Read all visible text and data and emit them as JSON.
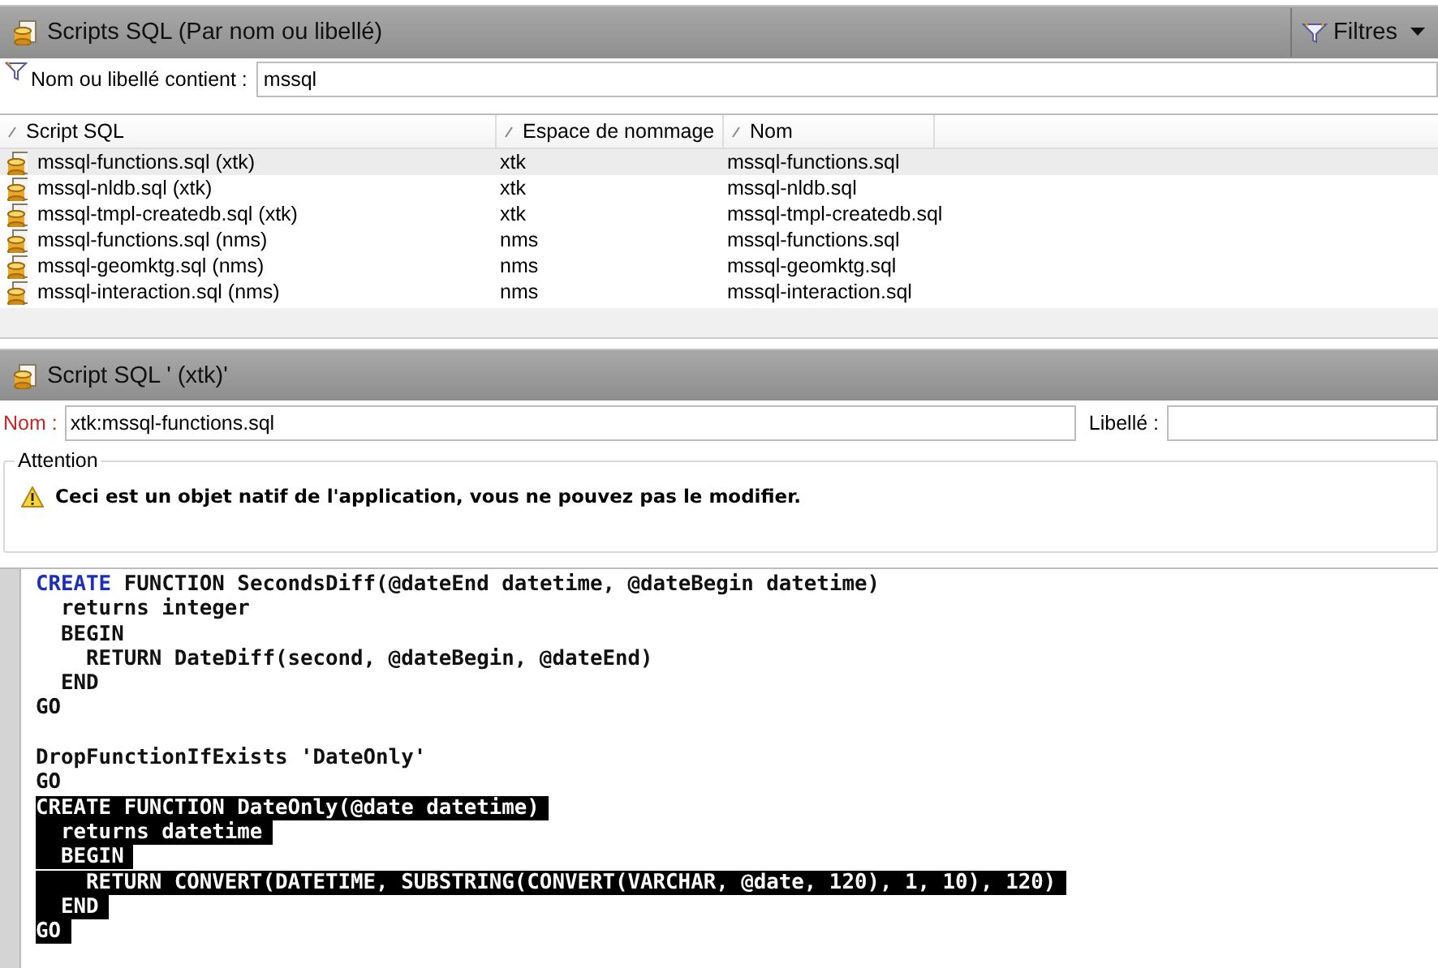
{
  "list_panel": {
    "title": "Scripts SQL (Par nom ou libellé)",
    "filter_button": "Filtres",
    "filter": {
      "label": "Nom ou libellé contient :",
      "value": "mssql"
    },
    "table": {
      "columns": [
        "Script SQL",
        "Espace de nommage",
        "Nom"
      ],
      "rows": [
        {
          "cells": [
            "mssql-functions.sql (xtk)",
            "xtk",
            "mssql-functions.sql"
          ],
          "selected": true
        },
        {
          "cells": [
            "mssql-nldb.sql (xtk)",
            "xtk",
            "mssql-nldb.sql"
          ],
          "selected": false
        },
        {
          "cells": [
            "mssql-tmpl-createdb.sql (xtk)",
            "xtk",
            "mssql-tmpl-createdb.sql"
          ],
          "selected": false
        },
        {
          "cells": [
            "mssql-functions.sql (nms)",
            "nms",
            "mssql-functions.sql"
          ],
          "selected": false
        },
        {
          "cells": [
            "mssql-geomktg.sql (nms)",
            "nms",
            "mssql-geomktg.sql"
          ],
          "selected": false
        },
        {
          "cells": [
            "mssql-interaction.sql (nms)",
            "nms",
            "mssql-interaction.sql"
          ],
          "selected": false
        }
      ]
    }
  },
  "detail_panel": {
    "title": "Script SQL ' (xtk)'",
    "fields": [
      {
        "label": "Nom :",
        "value": "xtk:mssql-functions.sql",
        "required": true
      },
      {
        "label": "Libellé :",
        "required": false
      }
    ],
    "warning": {
      "title": "Attention",
      "message": "Ceci est un objet natif de l'application, vous ne pouvez pas le modifier."
    },
    "code": {
      "lines": [
        {
          "kind": "code",
          "selected": false,
          "parts": [
            {
              "text": "CREATE",
              "kind": "keyword"
            },
            {
              "text": " FUNCTION SecondsDiff(@dateEnd datetime, @dateBegin datetime)",
              "kind": "plain"
            }
          ]
        },
        {
          "kind": "code",
          "selected": false,
          "parts": [
            {
              "text": "  returns integer",
              "kind": "plain"
            }
          ]
        },
        {
          "kind": "code",
          "selected": false,
          "parts": [
            {
              "text": "  BEGIN",
              "kind": "plain"
            }
          ]
        },
        {
          "kind": "code",
          "selected": false,
          "parts": [
            {
              "text": "    RETURN DateDiff(second, @dateBegin, @dateEnd)",
              "kind": "plain"
            }
          ]
        },
        {
          "kind": "code",
          "selected": false,
          "parts": [
            {
              "text": "  END",
              "kind": "plain"
            }
          ]
        },
        {
          "kind": "code",
          "selected": false,
          "parts": [
            {
              "text": "GO",
              "kind": "plain"
            }
          ]
        },
        {
          "kind": "blank"
        },
        {
          "kind": "code",
          "selected": false,
          "parts": [
            {
              "text": "DropFunctionIfExists 'DateOnly'",
              "kind": "plain"
            }
          ]
        },
        {
          "kind": "code",
          "selected": false,
          "parts": [
            {
              "text": "GO",
              "kind": "plain"
            }
          ]
        },
        {
          "kind": "code",
          "selected": true,
          "parts": [
            {
              "text": "CREATE FUNCTION DateOnly(@date datetime)",
              "kind": "plain"
            }
          ]
        },
        {
          "kind": "code",
          "selected": true,
          "parts": [
            {
              "text": "  returns datetime",
              "kind": "plain"
            }
          ]
        },
        {
          "kind": "code",
          "selected": true,
          "parts": [
            {
              "text": "  BEGIN",
              "kind": "plain"
            }
          ]
        },
        {
          "kind": "code",
          "selected": true,
          "parts": [
            {
              "text": "    RETURN CONVERT(DATETIME, SUBSTRING(CONVERT(VARCHAR, @date, 120), 1, 10), 120)",
              "kind": "plain"
            }
          ]
        },
        {
          "kind": "code",
          "selected": true,
          "parts": [
            {
              "text": "  END",
              "kind": "plain"
            }
          ]
        },
        {
          "kind": "code",
          "selected": true,
          "parts": [
            {
              "text": "GO",
              "kind": "plain"
            }
          ]
        }
      ]
    }
  }
}
